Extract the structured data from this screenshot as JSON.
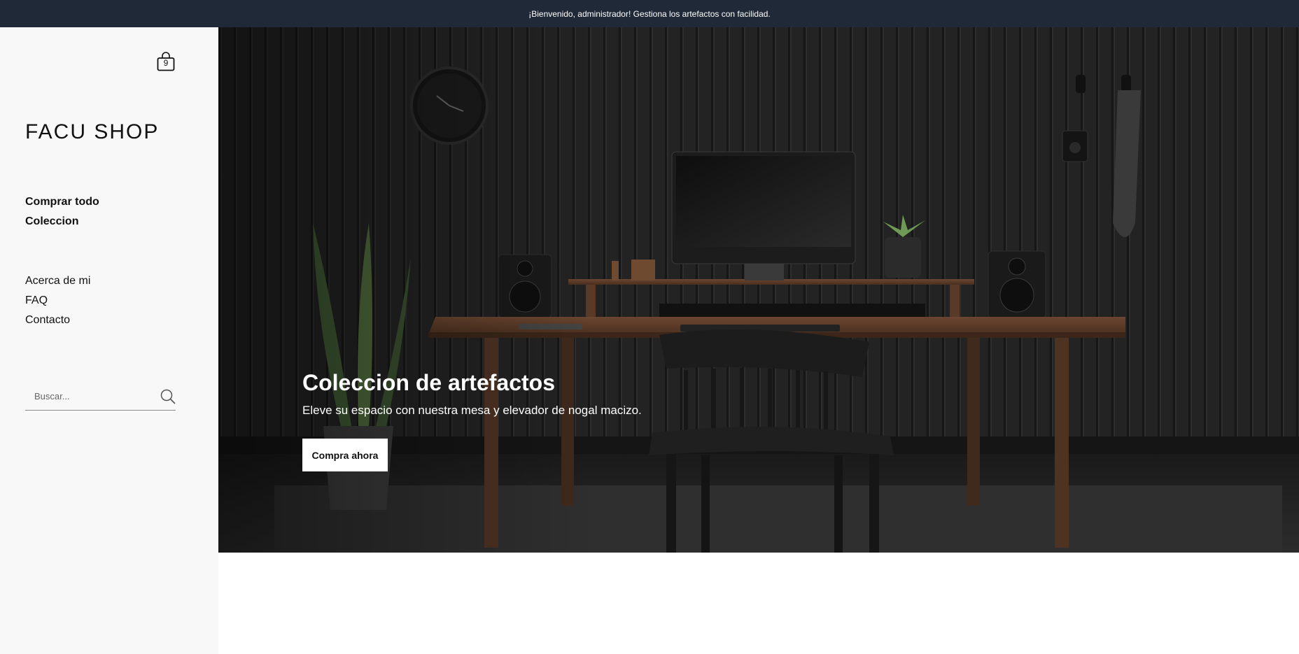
{
  "announcement": "¡Bienvenido, administrador! Gestiona los artefactos con facilidad.",
  "sidebar": {
    "cart_count": "9",
    "brand": "FACU SHOP",
    "primary_nav": [
      {
        "label": "Comprar todo"
      },
      {
        "label": "Coleccion"
      }
    ],
    "secondary_nav": [
      {
        "label": "Acerca de mi"
      },
      {
        "label": "FAQ"
      },
      {
        "label": "Contacto"
      }
    ],
    "search": {
      "placeholder": "Buscar..."
    }
  },
  "hero": {
    "title": "Coleccion de artefactos",
    "subtitle": "Eleve su espacio con nuestra mesa y elevador de nogal macizo.",
    "cta_label": "Compra ahora"
  },
  "icons": {
    "cart": "shopping-bag-icon",
    "search": "search-icon"
  },
  "colors": {
    "announcement_bg": "#1f2937",
    "sidebar_bg": "#f8f8f8",
    "cta_bg": "#ffffff"
  }
}
